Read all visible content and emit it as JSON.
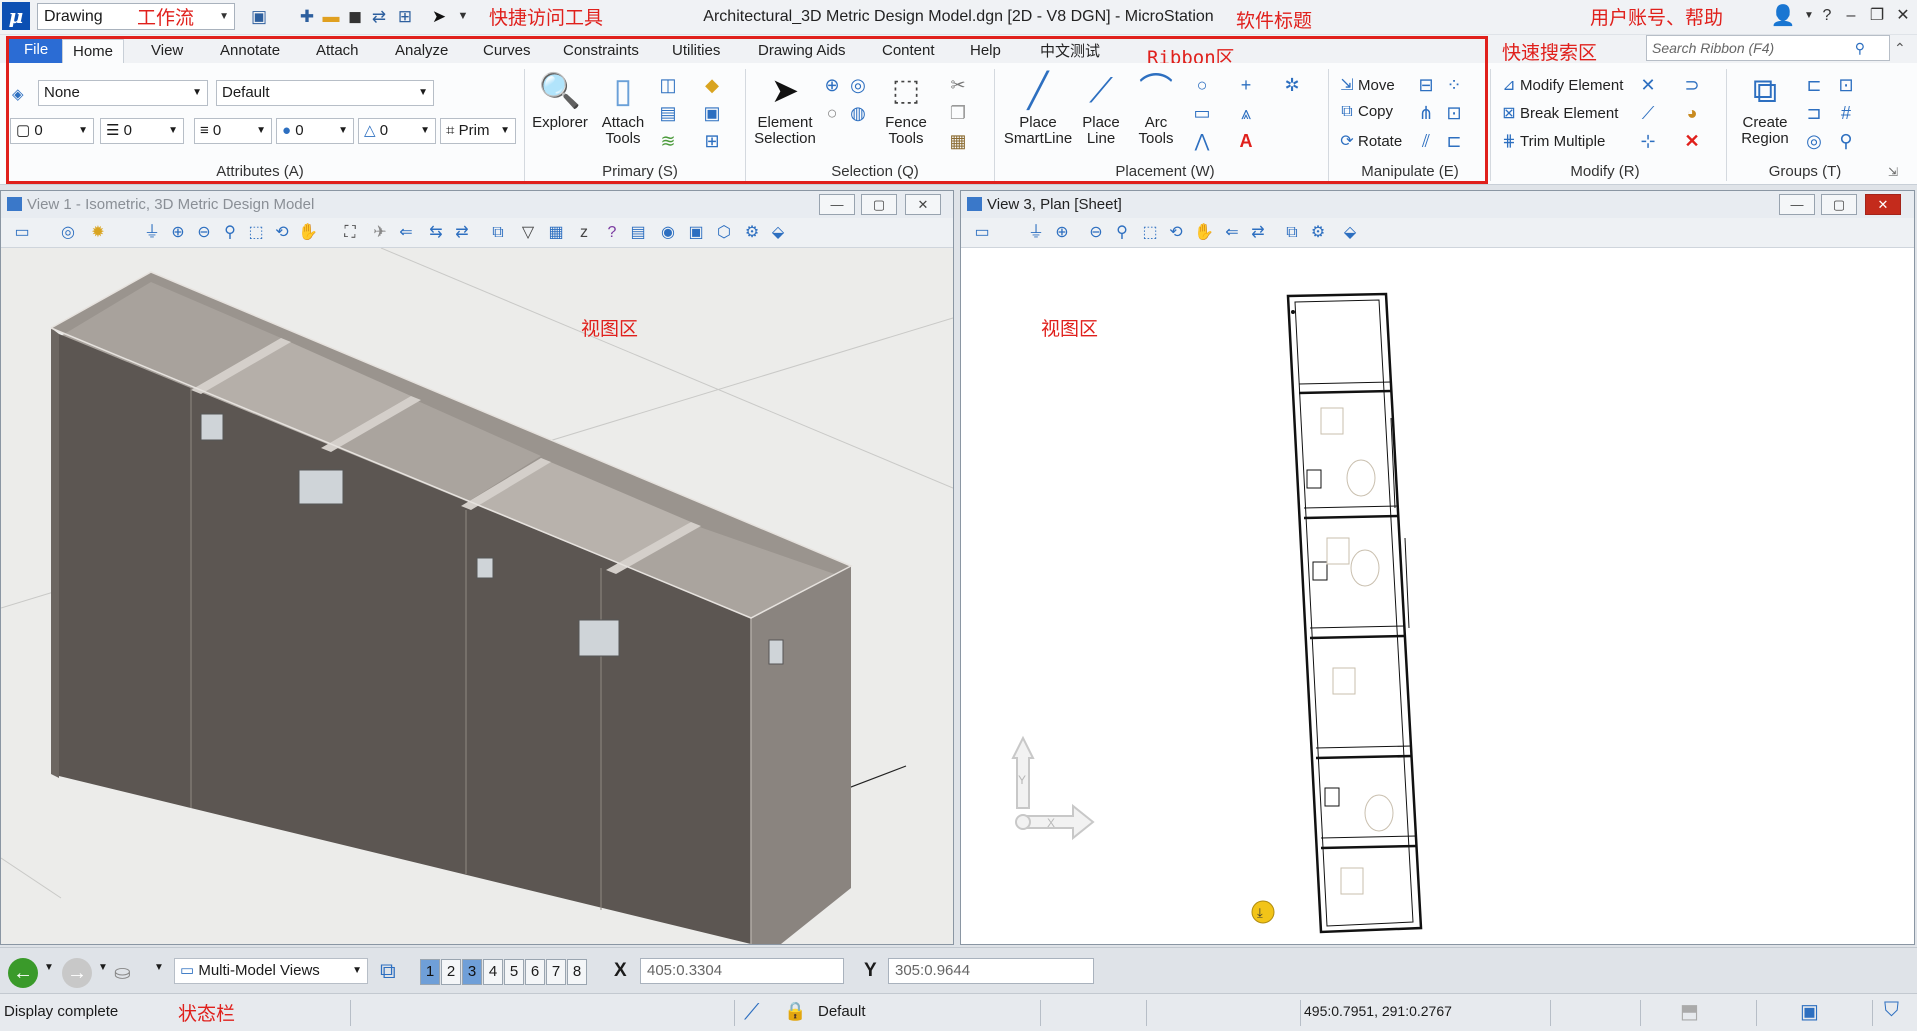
{
  "title_bar": {
    "workflow": "Drawing",
    "window_title": "Architectural_3D Metric Design Model.dgn [2D - V8 DGN] - MicroStation",
    "annotations": {
      "workflow": "工作流",
      "quick_access": "快捷访问工具",
      "software_title": "软件标题",
      "user_help": "用户账号、帮助",
      "ribbon": "Ribbon区",
      "search": "快速搜索区",
      "view_area": "视图区",
      "status_bar": "状态栏"
    }
  },
  "ribbon": {
    "tabs": [
      "File",
      "Home",
      "View",
      "Annotate",
      "Attach",
      "Analyze",
      "Curves",
      "Constraints",
      "Utilities",
      "Drawing Aids",
      "Content",
      "Help",
      "中文测试"
    ],
    "active_tab": "Home",
    "search_placeholder": "Search Ribbon (F4)",
    "attributes": {
      "level": "None",
      "style": "Default",
      "color": "0",
      "line_style": "0",
      "weight": "0",
      "transparency": "0",
      "priority": "0",
      "prim": "Prim"
    },
    "groups": {
      "attributes": "Attributes (A)",
      "primary": "Primary (S)",
      "selection": "Selection (Q)",
      "placement": "Placement (W)",
      "manipulate": "Manipulate (E)",
      "modify": "Modify (R)",
      "groups": "Groups (T)"
    },
    "buttons": {
      "explorer": "Explorer",
      "attach_tools_1": "Attach",
      "attach_tools_2": "Tools",
      "element_selection_1": "Element",
      "element_selection_2": "Selection",
      "fence_tools_1": "Fence",
      "fence_tools_2": "Tools",
      "place_smartline_1": "Place",
      "place_smartline_2": "SmartLine",
      "place_line_1": "Place",
      "place_line_2": "Line",
      "arc_tools_1": "Arc",
      "arc_tools_2": "Tools",
      "move": "Move",
      "copy": "Copy",
      "rotate": "Rotate",
      "modify_element": "Modify Element",
      "break_element": "Break Element",
      "trim_multiple": "Trim Multiple",
      "create_region_1": "Create",
      "create_region_2": "Region"
    }
  },
  "views": {
    "view1_title": "View 1 - Isometric, 3D Metric Design Model",
    "view3_title": "View 3, Plan [Sheet]"
  },
  "status_toolbar": {
    "model_combo": "Multi-Model Views",
    "view_numbers": [
      "1",
      "2",
      "3",
      "4",
      "5",
      "6",
      "7",
      "8"
    ],
    "active_views": [
      "1",
      "3"
    ],
    "x_label": "X",
    "x_value": "405:0.3304",
    "y_label": "Y",
    "y_value": "305:0.9644"
  },
  "status_bar": {
    "message": "Display complete",
    "level": "Default",
    "coordinates": "495:0.7951, 291:0.2767"
  },
  "colors": {
    "accent": "#2b6cd4",
    "annotation_red": "#e0201c",
    "wall_dark": "#5c5652",
    "wall_light": "#8a847f"
  }
}
